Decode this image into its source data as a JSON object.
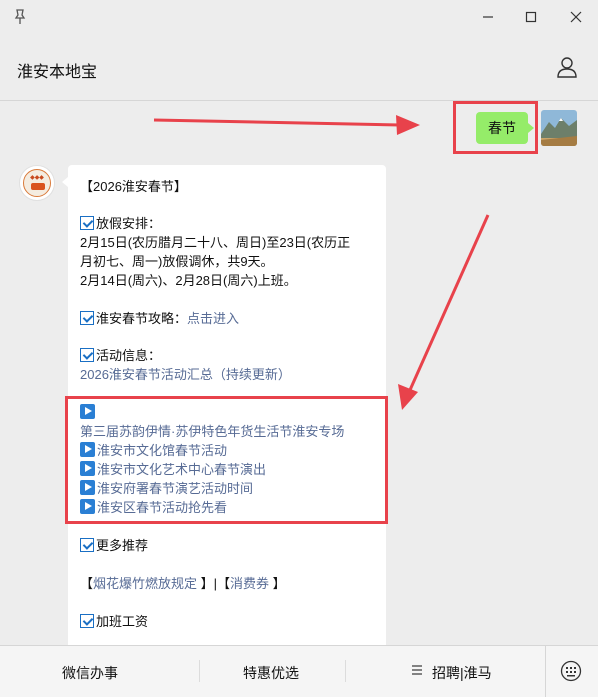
{
  "window": {
    "pin_icon": "pin-icon",
    "controls": [
      "minimize-icon",
      "maximize-icon",
      "close-icon"
    ]
  },
  "header": {
    "title": "淮安本地宝",
    "user_icon": "user-icon"
  },
  "sent_message": {
    "text": "春节"
  },
  "reply": {
    "title": "【2026淮安春节】",
    "holiday_heading": "放假安排：",
    "holiday_line1": "2月15日(农历腊月二十八、周日)至23日(农历正",
    "holiday_line2": "月初七、周一)放假调休，共9天。",
    "holiday_line3": "2月14日(周六)、2月28日(周六)上班。",
    "guide_label": "淮安春节攻略：",
    "guide_link": "点击进入",
    "activity_heading": "活动信息：",
    "activity_link": "2026淮安春节活动汇总（持续更新）",
    "events": [
      "第三届苏韵伊情·苏伊特色年货生活节淮安专场",
      "淮安市文化馆春节活动",
      "淮安市文化艺术中心春节演出",
      "淮安府署春节演艺活动时间",
      "淮安区春节活动抢先看"
    ],
    "more_heading": "更多推荐",
    "more_open": "【",
    "more_link1": "烟花爆竹燃放规定",
    "more_mid": " 】|【",
    "more_link2": "消费券",
    "more_close": " 】",
    "overtime_heading": "加班工资"
  },
  "footer": {
    "items": [
      "微信办事",
      "特惠优选",
      "招聘|淮马"
    ],
    "keyboard_icon": "keyboard-icon"
  },
  "colors": {
    "highlight": "#e8424b",
    "bubble_green": "#95ec69",
    "link": "#576b95",
    "checkbox": "#1a6fc4"
  }
}
